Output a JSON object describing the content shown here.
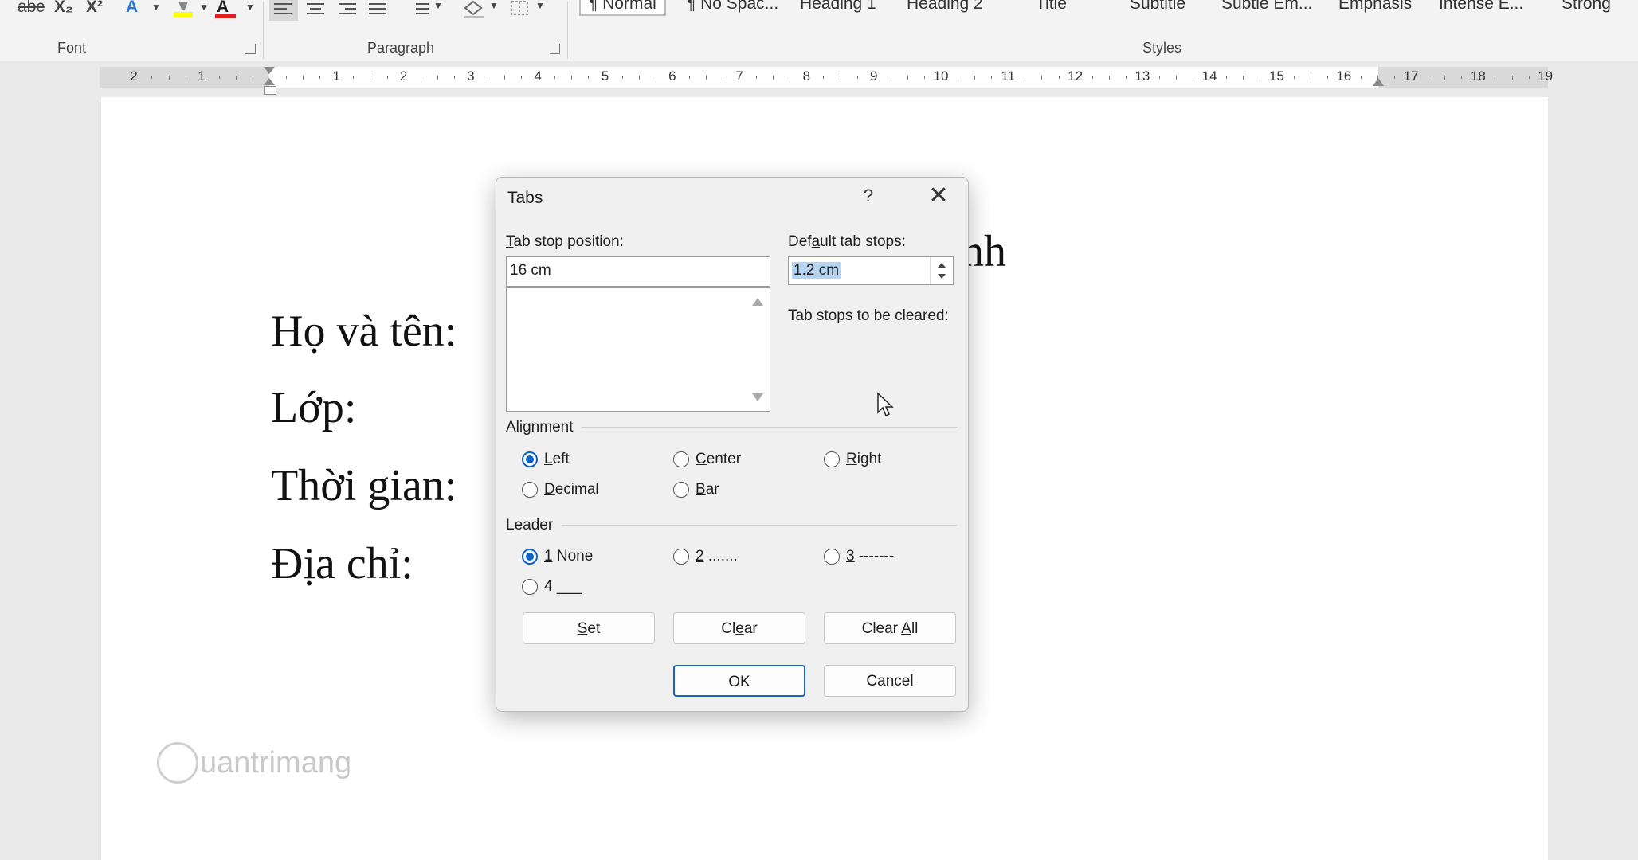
{
  "ribbon": {
    "font_group_label": "Font",
    "paragraph_group_label": "Paragraph",
    "styles_group_label": "Styles",
    "font_buttons": [
      "abc",
      "X₂",
      "X²",
      "A",
      "A"
    ],
    "styles": [
      {
        "label": "¶ Normal",
        "selected": true
      },
      {
        "label": "¶ No Spac..."
      },
      {
        "label": "Heading 1"
      },
      {
        "label": "Heading 2"
      },
      {
        "label": "Title"
      },
      {
        "label": "Subtitle"
      },
      {
        "label": "Subtle Em..."
      },
      {
        "label": "Emphasis"
      },
      {
        "label": "Intense E..."
      },
      {
        "label": "Strong"
      }
    ],
    "highlight_color": "#ffff00",
    "font_color": "#e02020"
  },
  "ruler": {
    "left_labels": [
      "2",
      "1"
    ],
    "labels": [
      "1",
      "2",
      "3",
      "4",
      "5",
      "6",
      "7",
      "8",
      "9",
      "10",
      "11",
      "12",
      "13",
      "14",
      "15",
      "16",
      "17",
      "18",
      "19"
    ]
  },
  "document": {
    "lines": [
      "Họ và tên:",
      "Lớp:",
      "Thời gian:",
      "Địa chỉ:"
    ],
    "partial_heading": "nh",
    "watermark": "uantrimang"
  },
  "dialog": {
    "title": "Tabs",
    "help": "?",
    "close": "✕",
    "tab_stop_label_u": "T",
    "tab_stop_label_rest": "ab stop position:",
    "tab_stop_value": "16 cm",
    "default_label_pre": "Def",
    "default_label_u": "a",
    "default_label_rest": "ult tab stops:",
    "default_value": "1.2 cm",
    "cleared_label": "Tab stops to be cleared:",
    "alignment_label": "Alignment",
    "alignment_options": [
      {
        "u": "L",
        "rest": "eft",
        "checked": true
      },
      {
        "u": "C",
        "rest": "enter",
        "checked": false
      },
      {
        "u": "R",
        "rest": "ight",
        "checked": false
      },
      {
        "u": "D",
        "rest": "ecimal",
        "checked": false
      },
      {
        "u": "B",
        "rest": "ar",
        "checked": false
      }
    ],
    "leader_label": "Leader",
    "leader_options": [
      {
        "u": "1",
        "rest": " None",
        "checked": true
      },
      {
        "u": "2",
        "rest": " .......",
        "checked": false
      },
      {
        "u": "3",
        "rest": " -------",
        "checked": false
      },
      {
        "u": "4",
        "rest": " ___",
        "checked": false
      }
    ],
    "buttons": {
      "set_u": "S",
      "set_rest": "et",
      "clear_pre": "Cl",
      "clear_u": "e",
      "clear_rest": "ar",
      "clearall_pre": "Clear ",
      "clearall_u": "A",
      "clearall_rest": "ll",
      "ok": "OK",
      "cancel": "Cancel"
    },
    "accent_color": "#0c62c9"
  }
}
